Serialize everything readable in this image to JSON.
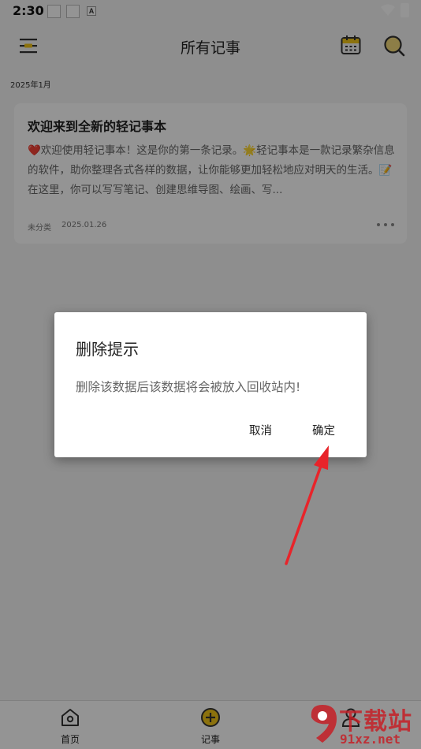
{
  "status_bar": {
    "time": "2:30",
    "a_badge": "A"
  },
  "header": {
    "title": "所有记事"
  },
  "list": {
    "month_label": "2025年1月",
    "notes": [
      {
        "title": "欢迎来到全新的轻记事本",
        "body": "❤️欢迎使用轻记事本！这是你的第一条记录。🌟轻记事本是一款记录繁杂信息的软件，助你整理各式各样的数据，让你能够更加轻松地应对明天的生活。📝在这里，你可以写写笔记、创建思维导图、绘画、写...",
        "category": "未分类",
        "date": "2025.01.26"
      }
    ]
  },
  "bottom_nav": {
    "home_label": "首页",
    "notes_label": "记事",
    "mine_label": ""
  },
  "dialog": {
    "title": "删除提示",
    "message": "删除该数据后该数据将会被放入回收站内!",
    "cancel_label": "取消",
    "ok_label": "确定"
  },
  "watermark": {
    "top_text": "下载站",
    "bottom_text": "91xz.net"
  },
  "colors": {
    "accent_yellow": "#f2c417",
    "arrow_red": "#e8242a",
    "watermark_red": "#c61e26"
  }
}
